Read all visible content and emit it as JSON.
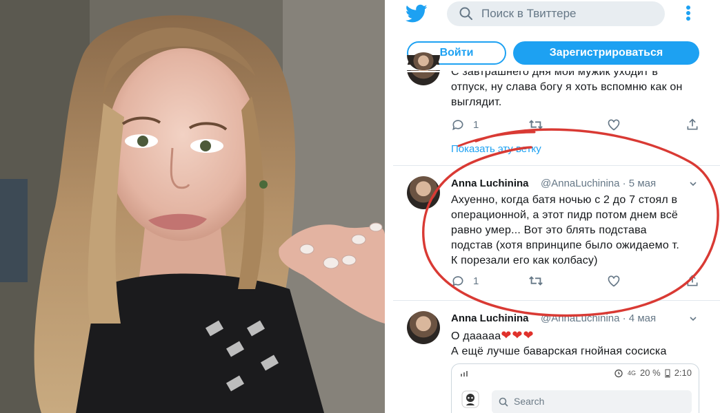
{
  "app": {
    "brand": "Twitter",
    "accent": "#1da1f2",
    "annotation_color": "#d93a34"
  },
  "header": {
    "search_placeholder": "Поиск в Твиттере",
    "login_label": "Войти",
    "signup_label": "Зарегистрироваться"
  },
  "tweets": [
    {
      "text_lines": [
        "С завтрашнего дня мой мужик уходит в",
        "отпуск, ну слава богу я хоть вспомню как он",
        "выглядит."
      ],
      "reply_count": "1",
      "show_thread": "Показать эту ветку"
    },
    {
      "author": "Anna Luchinina",
      "handle_date": "@AnnaLuchinina · 5 мая",
      "text_lines": [
        "Ахуенно, когда батя  ночью с 2 до 7 стоял в",
        "операционной, а этот пидр потом днем всё",
        "равно умер... Вот это блять подстава",
        "подстав (хотя впринципе было ожидаемо т.",
        "К порезали его как колбасу)"
      ],
      "reply_count": "1"
    },
    {
      "author": "Anna Luchinina",
      "handle_date": "@AnnaLuchinina · 4 мая",
      "text_lines": [
        "О дааааа",
        "А ещё лучше баварская гнойная сосиска"
      ],
      "emoji": "❤❤❤",
      "embedded": {
        "status": {
          "battery": "20 %",
          "time": "2:10",
          "network": "4G"
        },
        "search_placeholder": "Search"
      }
    }
  ],
  "icons": [
    "twitter-bird-icon",
    "search-icon",
    "more-vertical-icon",
    "reply-icon",
    "retweet-icon",
    "like-icon",
    "share-icon",
    "chevron-down-icon"
  ]
}
